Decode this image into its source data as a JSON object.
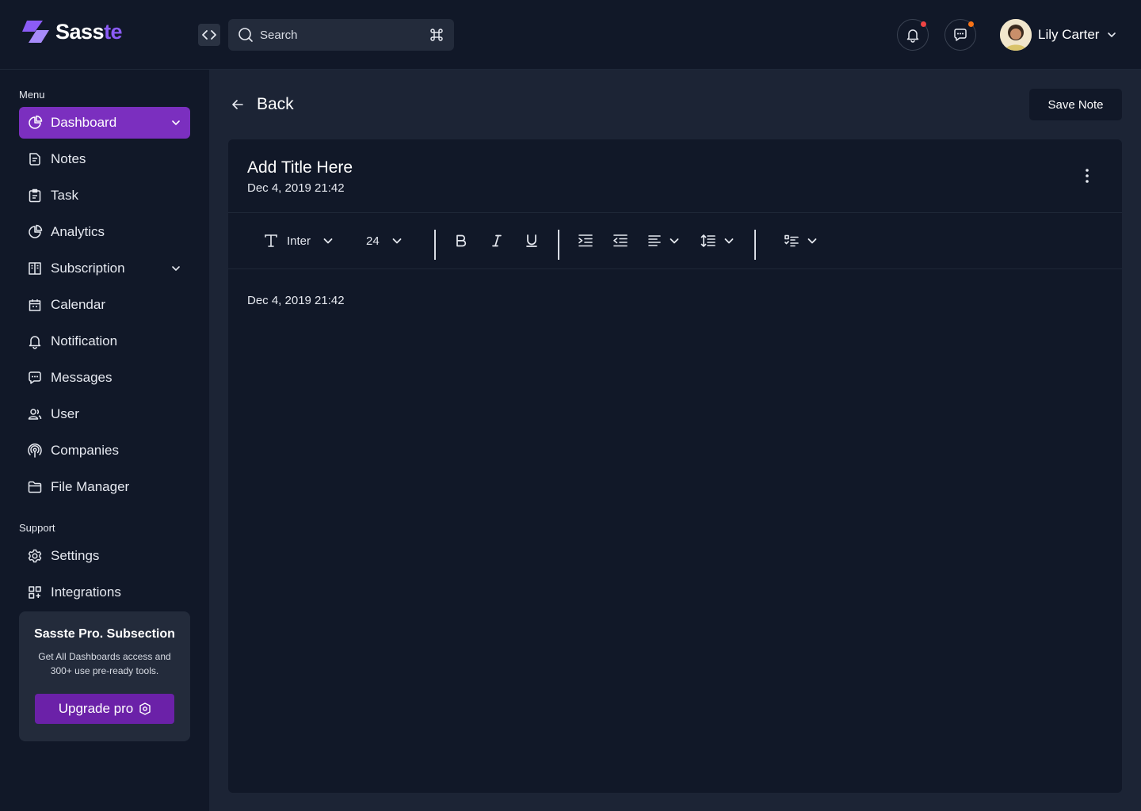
{
  "brand": {
    "name_main": "Sass",
    "name_accent": "te",
    "accent_color": "#8b5cf6"
  },
  "header": {
    "search_placeholder": "Search",
    "notification_dot_color": "#ef4444",
    "message_dot_color": "#f97316",
    "user_name": "Lily Carter"
  },
  "sidebar": {
    "menu_label": "Menu",
    "items": [
      {
        "label": "Dashboard",
        "icon": "pie-chart-icon",
        "active": true,
        "has_chevron": true
      },
      {
        "label": "Notes",
        "icon": "note-icon"
      },
      {
        "label": "Task",
        "icon": "clipboard-icon"
      },
      {
        "label": "Analytics",
        "icon": "pie-chart-icon"
      },
      {
        "label": "Subscription",
        "icon": "columns-icon",
        "has_chevron": true
      },
      {
        "label": "Calendar",
        "icon": "calendar-icon"
      },
      {
        "label": "Notification",
        "icon": "bell-icon"
      },
      {
        "label": "Messages",
        "icon": "chat-icon"
      },
      {
        "label": "User",
        "icon": "users-icon"
      },
      {
        "label": "Companies",
        "icon": "broadcast-icon"
      },
      {
        "label": "File Manager",
        "icon": "folder-icon"
      }
    ],
    "support_label": "Support",
    "support_items": [
      {
        "label": "Settings",
        "icon": "gear-icon"
      },
      {
        "label": "Integrations",
        "icon": "grid-plus-icon"
      }
    ],
    "promo": {
      "title": "Sasste Pro. Subsection",
      "description": "Get All Dashboards access and 300+ use pre-ready tools.",
      "button_label": "Upgrade pro"
    }
  },
  "main": {
    "back_label": "Back",
    "save_label": "Save Note",
    "note": {
      "title": "Add Title Here",
      "date": "Dec 4, 2019 21:42",
      "body": "Dec 4, 2019 21:42"
    },
    "toolbar": {
      "font": "Inter",
      "size": "24"
    }
  }
}
